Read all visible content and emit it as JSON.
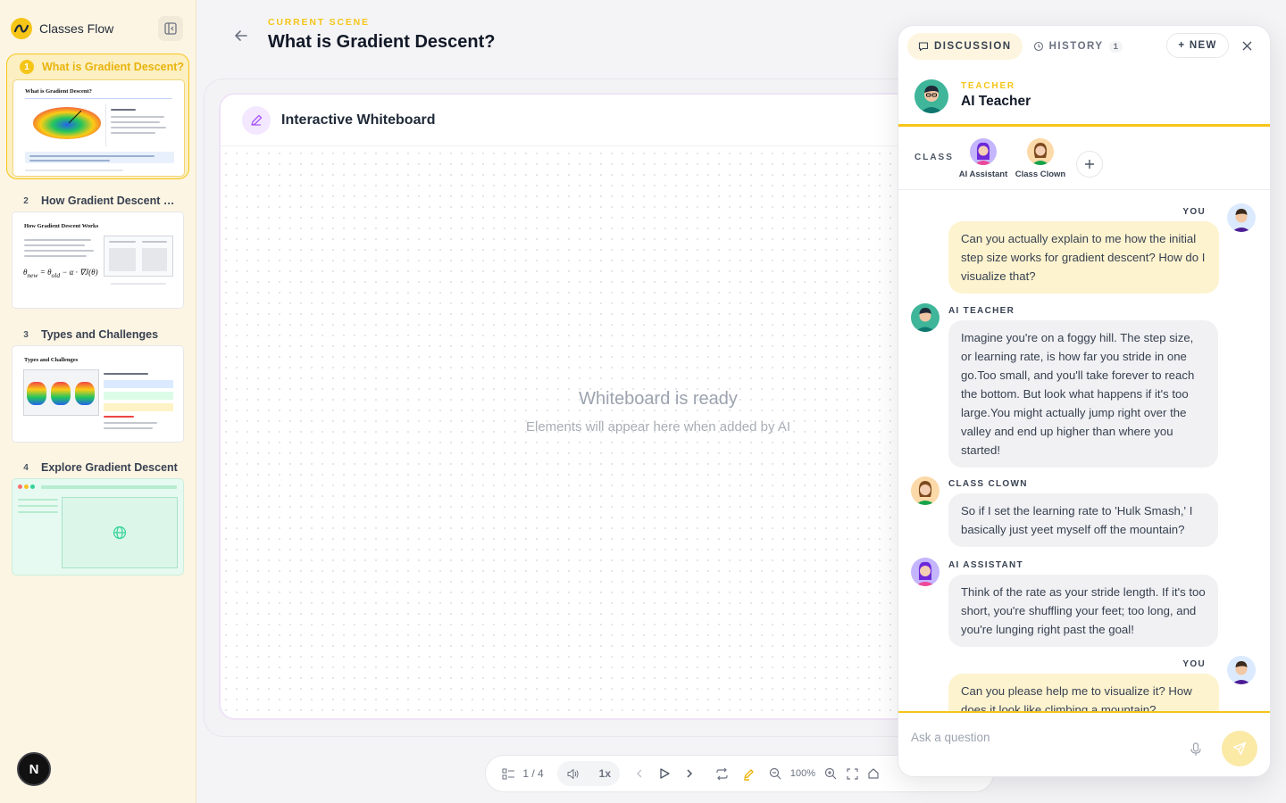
{
  "app": {
    "title": "Classes Flow"
  },
  "scenes": [
    {
      "num": "1",
      "title": "What is Gradient Descent?",
      "thumb_title": "What is Gradient Descent?"
    },
    {
      "num": "2",
      "title": "How Gradient Descent Works",
      "thumb_title": "How Gradient Descent Works"
    },
    {
      "num": "3",
      "title": "Types and Challenges",
      "thumb_title": "Types and Challenges"
    },
    {
      "num": "4",
      "title": "Explore Gradient Descent",
      "thumb_title": ""
    }
  ],
  "user_avatar_letter": "N",
  "header": {
    "eyebrow": "CURRENT SCENE",
    "title": "What is Gradient Descent?"
  },
  "whiteboard": {
    "title": "Interactive Whiteboard",
    "ready_title": "Whiteboard is ready",
    "ready_subtitle": "Elements will appear here when added by AI"
  },
  "toolbar": {
    "page": "1 / 4",
    "speed": "1x",
    "zoom": "100%"
  },
  "chat": {
    "tabs": [
      {
        "label": "DISCUSSION",
        "active": true
      },
      {
        "label": "HISTORY",
        "badge": "1",
        "active": false
      }
    ],
    "new_label": "+ NEW",
    "teacher": {
      "role": "TEACHER",
      "name": "AI Teacher"
    },
    "class_label": "CLASS",
    "class_members": [
      {
        "name": "AI Assistant"
      },
      {
        "name": "Class Clown"
      }
    ],
    "messages": [
      {
        "sender": "YOU",
        "role": "user",
        "text": "Can you actually explain to me how the initial step size works for gradient descent? How do I visualize that?"
      },
      {
        "sender": "AI TEACHER",
        "role": "teacher",
        "text": "Imagine you're on a foggy hill. The step size, or learning rate, is how far you stride in one go.Too small, and you'll take forever to reach the bottom. But look what happens if it's too large.You might actually jump right over the valley and end up higher than where you started!"
      },
      {
        "sender": "CLASS CLOWN",
        "role": "clown",
        "text": "So if I set the learning rate to 'Hulk Smash,' I basically just yeet myself off the mountain?"
      },
      {
        "sender": "AI ASSISTANT",
        "role": "assistant",
        "text": "Think of the rate as your stride length. If it's too short, you're shuffling your feet; too long, and you're lunging right past the goal!"
      },
      {
        "sender": "YOU",
        "role": "user",
        "text": "Can you please help me to visualize it? How does it look like climbing a mountain?"
      }
    ],
    "input_placeholder": "Ask a question"
  },
  "colors": {
    "accent": "#f5c518",
    "user_bubble": "#fdf3cf",
    "ai_bubble": "#f1f1f3",
    "sidebar_bg": "#fdf5e3"
  }
}
